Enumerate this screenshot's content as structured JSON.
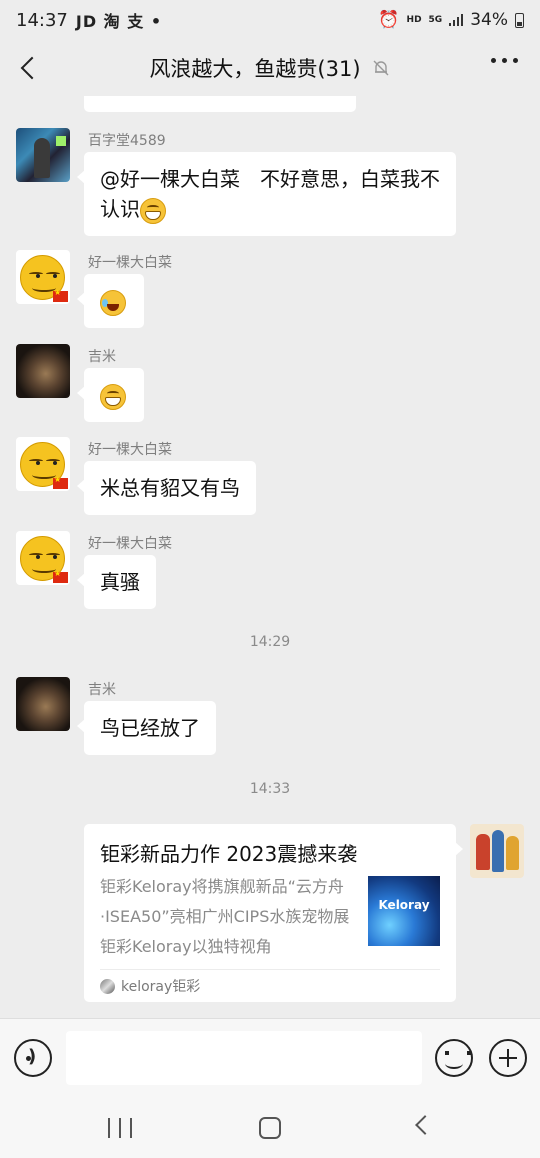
{
  "status_bar": {
    "time": "14:37",
    "app_icons": "JD 淘 支 •",
    "hd": "HD",
    "network": "5G",
    "battery": "34%"
  },
  "header": {
    "title": "风浪越大，鱼越贵(31)"
  },
  "messages": [
    {
      "sender": "百字堂4589",
      "text": "@好一棵大白菜　不好意思，白菜我不认识",
      "avatar": "game-character-avatar"
    },
    {
      "sender": "好一棵大白菜",
      "text": "",
      "emoji": "laughing-tears-emoji",
      "avatar": "smiley-avatar"
    },
    {
      "sender": "吉米",
      "text": "",
      "emoji": "grin-emoji",
      "avatar": "dark-photo-avatar"
    },
    {
      "sender": "好一棵大白菜",
      "text": "米总有貂又有鸟",
      "avatar": "smiley-avatar"
    },
    {
      "sender": "好一棵大白菜",
      "text": "真骚",
      "avatar": "smiley-avatar"
    },
    {
      "sender": "吉米",
      "text": "鸟已经放了",
      "avatar": "dark-photo-avatar"
    }
  ],
  "timestamps": [
    "14:29",
    "14:33"
  ],
  "shared_card": {
    "title": "钜彩新品力作 2023震撼来袭",
    "description": "钜彩Keloray将携旗舰新品“云方舟·ISEA50”亮相广州CIPS水族宠物展钜彩Keloray以独特视角",
    "thumbnail_text": "Keloray",
    "source": "keloray钜彩"
  },
  "input": {
    "placeholder": ""
  }
}
